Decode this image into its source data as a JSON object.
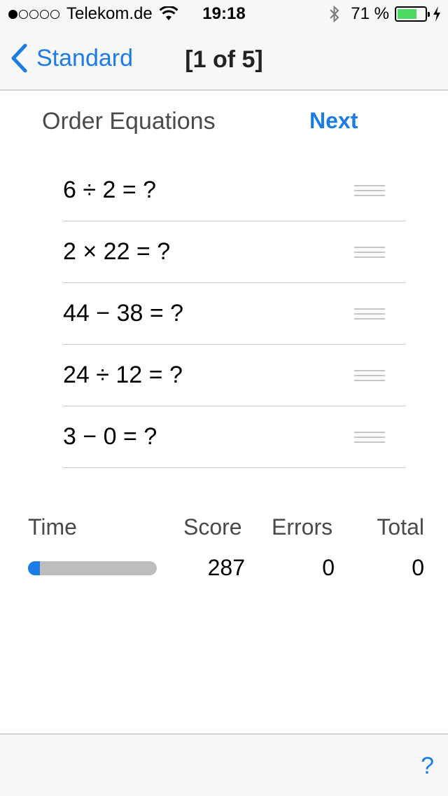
{
  "status_bar": {
    "carrier": "Telekom.de",
    "signal_bars_filled": 1,
    "signal_bars_total": 5,
    "time": "19:18",
    "battery_percent": "71 %",
    "battery_level": 0.71,
    "battery_color": "#4cd964"
  },
  "nav": {
    "back_label": "Standard",
    "title": "[1 of 5]"
  },
  "header": {
    "title": "Order Equations",
    "next_label": "Next"
  },
  "equations": [
    "6 ÷ 2 = ?",
    "2 × 22 = ?",
    "44 − 38 = ?",
    "24 ÷ 12 = ?",
    "3 − 0 = ?"
  ],
  "stats": {
    "time_label": "Time",
    "score_label": "Score",
    "errors_label": "Errors",
    "total_label": "Total",
    "score_value": "287",
    "errors_value": "0",
    "total_value": "0",
    "time_progress": 0.09
  },
  "toolbar": {
    "help_label": "?"
  },
  "colors": {
    "accent": "#1a7ce4"
  }
}
